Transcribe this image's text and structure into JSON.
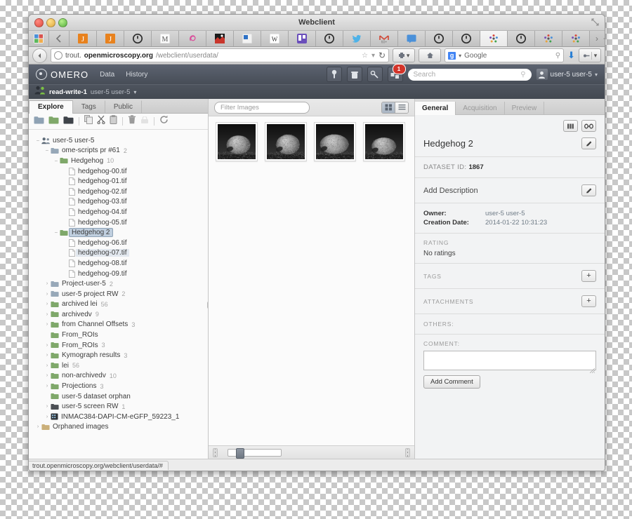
{
  "window": {
    "title": "Webclient"
  },
  "browser": {
    "url_prefix": "trout.",
    "url_domain": "openmicroscopy.org",
    "url_path": "/webclient/userdata/",
    "search_engine": "Google",
    "tabs": [
      {
        "icon": "app-grid-icon",
        "label": ""
      },
      {
        "icon": "chevron-left-icon",
        "label": ""
      },
      {
        "icon": "jenkins-icon",
        "label": "J"
      },
      {
        "icon": "jenkins-icon",
        "label": "J"
      },
      {
        "icon": "github-icon",
        "label": ""
      },
      {
        "icon": "m-letter-icon",
        "label": "M"
      },
      {
        "icon": "spiral-icon",
        "label": ""
      },
      {
        "icon": "debian-icon",
        "label": ""
      },
      {
        "icon": "blue-square-icon",
        "label": ""
      },
      {
        "icon": "wikipedia-icon",
        "label": "W"
      },
      {
        "icon": "trello-icon",
        "label": ""
      },
      {
        "icon": "github-icon",
        "label": ""
      },
      {
        "icon": "twitter-icon",
        "label": ""
      },
      {
        "icon": "gmail-icon",
        "label": ""
      },
      {
        "icon": "blue-chat-icon",
        "label": ""
      },
      {
        "icon": "github-icon",
        "label": ""
      },
      {
        "icon": "github-icon",
        "label": ""
      },
      {
        "icon": "omero-dots-icon",
        "label": ""
      },
      {
        "icon": "github-icon",
        "label": ""
      },
      {
        "icon": "omero-dots-icon",
        "label": ""
      },
      {
        "icon": "omero-dots-icon",
        "label": ""
      }
    ],
    "tab_overflow": "›",
    "new_tab": "+",
    "tab_menu": "▾"
  },
  "omero": {
    "brand": "OMERO",
    "nav": [
      {
        "label": "Data"
      },
      {
        "label": "History"
      }
    ],
    "header_icons": [
      {
        "name": "pin-icon"
      },
      {
        "name": "trash-icon"
      },
      {
        "name": "script-icon"
      },
      {
        "name": "activities-icon",
        "badge": "1"
      }
    ],
    "search_placeholder": "Search",
    "user_label": "user-5 user-5",
    "group": {
      "name": "read-write-1",
      "user": "user-5 user-5"
    }
  },
  "left_panel": {
    "tabs": [
      {
        "label": "Explore",
        "active": true
      },
      {
        "label": "Tags",
        "active": false
      },
      {
        "label": "Public",
        "active": false
      }
    ],
    "toolbar": [
      {
        "name": "new-project-icon"
      },
      {
        "name": "new-dataset-icon"
      },
      {
        "name": "new-screen-icon"
      },
      {
        "name": "copy-icon"
      },
      {
        "name": "cut-icon"
      },
      {
        "name": "paste-icon"
      },
      {
        "name": "delete-icon"
      },
      {
        "name": "delete-disabled-icon"
      },
      {
        "name": "refresh-icon"
      }
    ],
    "tree": [
      {
        "indent": 0,
        "twisty": "-",
        "icon": "user-icon",
        "label": "user-5 user-5",
        "count": "",
        "state": ""
      },
      {
        "indent": 1,
        "twisty": "-",
        "icon": "project-icon",
        "label": "ome-scripts pr #61",
        "count": "2",
        "state": ""
      },
      {
        "indent": 2,
        "twisty": "-",
        "icon": "dataset-icon",
        "label": "Hedgehog",
        "count": "10",
        "state": ""
      },
      {
        "indent": 3,
        "twisty": "",
        "icon": "image-icon",
        "label": "hedgehog-00.tif",
        "count": "",
        "state": ""
      },
      {
        "indent": 3,
        "twisty": "",
        "icon": "image-icon",
        "label": "hedgehog-01.tif",
        "count": "",
        "state": ""
      },
      {
        "indent": 3,
        "twisty": "",
        "icon": "image-icon",
        "label": "hedgehog-02.tif",
        "count": "",
        "state": ""
      },
      {
        "indent": 3,
        "twisty": "",
        "icon": "image-icon",
        "label": "hedgehog-03.tif",
        "count": "",
        "state": ""
      },
      {
        "indent": 3,
        "twisty": "",
        "icon": "image-icon",
        "label": "hedgehog-04.tif",
        "count": "",
        "state": ""
      },
      {
        "indent": 3,
        "twisty": "",
        "icon": "image-icon",
        "label": "hedgehog-05.tif",
        "count": "",
        "state": ""
      },
      {
        "indent": 2,
        "twisty": "-",
        "icon": "dataset-icon",
        "label": "Hedgehog 2",
        "count": "",
        "state": "sel"
      },
      {
        "indent": 3,
        "twisty": "",
        "icon": "image-icon",
        "label": "hedgehog-06.tif",
        "count": "",
        "state": ""
      },
      {
        "indent": 3,
        "twisty": "",
        "icon": "image-icon",
        "label": "hedgehog-07.tif",
        "count": "",
        "state": "sel2"
      },
      {
        "indent": 3,
        "twisty": "",
        "icon": "image-icon",
        "label": "hedgehog-08.tif",
        "count": "",
        "state": ""
      },
      {
        "indent": 3,
        "twisty": "",
        "icon": "image-icon",
        "label": "hedgehog-09.tif",
        "count": "",
        "state": ""
      },
      {
        "indent": 1,
        "twisty": "+",
        "icon": "project-icon",
        "label": "Project-user-5",
        "count": "2",
        "state": ""
      },
      {
        "indent": 1,
        "twisty": "+",
        "icon": "project-icon",
        "label": "user-5 project RW",
        "count": "2",
        "state": ""
      },
      {
        "indent": 1,
        "twisty": "+",
        "icon": "dataset-icon",
        "label": "archived lei",
        "count": "56",
        "state": ""
      },
      {
        "indent": 1,
        "twisty": "+",
        "icon": "dataset-icon",
        "label": "archivedv",
        "count": "9",
        "state": ""
      },
      {
        "indent": 1,
        "twisty": "+",
        "icon": "dataset-icon",
        "label": "from Channel Offsets",
        "count": "3",
        "state": ""
      },
      {
        "indent": 1,
        "twisty": "",
        "icon": "dataset-icon",
        "label": "From_ROIs",
        "count": "",
        "state": ""
      },
      {
        "indent": 1,
        "twisty": "+",
        "icon": "dataset-icon",
        "label": "From_ROIs",
        "count": "3",
        "state": ""
      },
      {
        "indent": 1,
        "twisty": "+",
        "icon": "dataset-icon",
        "label": "Kymograph results",
        "count": "3",
        "state": ""
      },
      {
        "indent": 1,
        "twisty": "+",
        "icon": "dataset-icon",
        "label": "lei",
        "count": "56",
        "state": ""
      },
      {
        "indent": 1,
        "twisty": "+",
        "icon": "dataset-icon",
        "label": "non-archivedv",
        "count": "10",
        "state": ""
      },
      {
        "indent": 1,
        "twisty": "+",
        "icon": "dataset-icon",
        "label": "Projections",
        "count": "3",
        "state": ""
      },
      {
        "indent": 1,
        "twisty": "",
        "icon": "dataset-icon",
        "label": "user-5 dataset orphan",
        "count": "",
        "state": ""
      },
      {
        "indent": 1,
        "twisty": "+",
        "icon": "screen-icon",
        "label": "user-5 screen RW",
        "count": "1",
        "state": ""
      },
      {
        "indent": 1,
        "twisty": "+",
        "icon": "plate-icon",
        "label": "INMAC384-DAPI-CM-eGFP_59223_1",
        "count": "",
        "state": ""
      },
      {
        "indent": 0,
        "twisty": "+",
        "icon": "orphan-icon",
        "label": "Orphaned images",
        "count": "",
        "state": ""
      }
    ]
  },
  "center_panel": {
    "filter_placeholder": "Filter Images",
    "view_modes": [
      {
        "name": "grid-view-icon",
        "active": true
      },
      {
        "name": "list-view-icon",
        "active": false
      }
    ],
    "thumbnails": [
      {
        "name": "hedgehog-06-thumbnail",
        "seed": 1
      },
      {
        "name": "hedgehog-07-thumbnail",
        "seed": 2
      },
      {
        "name": "hedgehog-08-thumbnail",
        "seed": 3
      },
      {
        "name": "hedgehog-09-thumbnail",
        "seed": 4
      }
    ],
    "zoom_slider_value": 15
  },
  "right_panel": {
    "tabs": [
      {
        "label": "General",
        "active": true
      },
      {
        "label": "Acquisition",
        "active": false
      },
      {
        "label": "Preview",
        "active": false
      }
    ],
    "header_buttons": [
      {
        "name": "thumbnail-grid-icon"
      },
      {
        "name": "link-icon"
      }
    ],
    "title": "Hedgehog 2",
    "dataset_id_label": "DATASET ID:",
    "dataset_id_value": "1867",
    "description_placeholder": "Add Description",
    "fields": [
      {
        "key": "Owner:",
        "value": "user-5 user-5"
      },
      {
        "key": "Creation Date:",
        "value": "2014-01-22 10:31:23"
      }
    ],
    "rating_label": "RATING",
    "rating_value": "No ratings",
    "tags_label": "TAGS",
    "attachments_label": "ATTACHMENTS",
    "others_label": "OTHERS:",
    "comment_label": "COMMENT:",
    "comment_value": "",
    "add_comment_label": "Add Comment"
  },
  "statusbar": {
    "text": "trout.openmicroscopy.org/webclient/userdata/#"
  },
  "colors": {
    "omero_header": "#4e545e",
    "accent_badge": "#d3342a",
    "selection": "#bfcede",
    "dataset_green": "#7fa86a",
    "project_blue": "#8fa2b4"
  }
}
